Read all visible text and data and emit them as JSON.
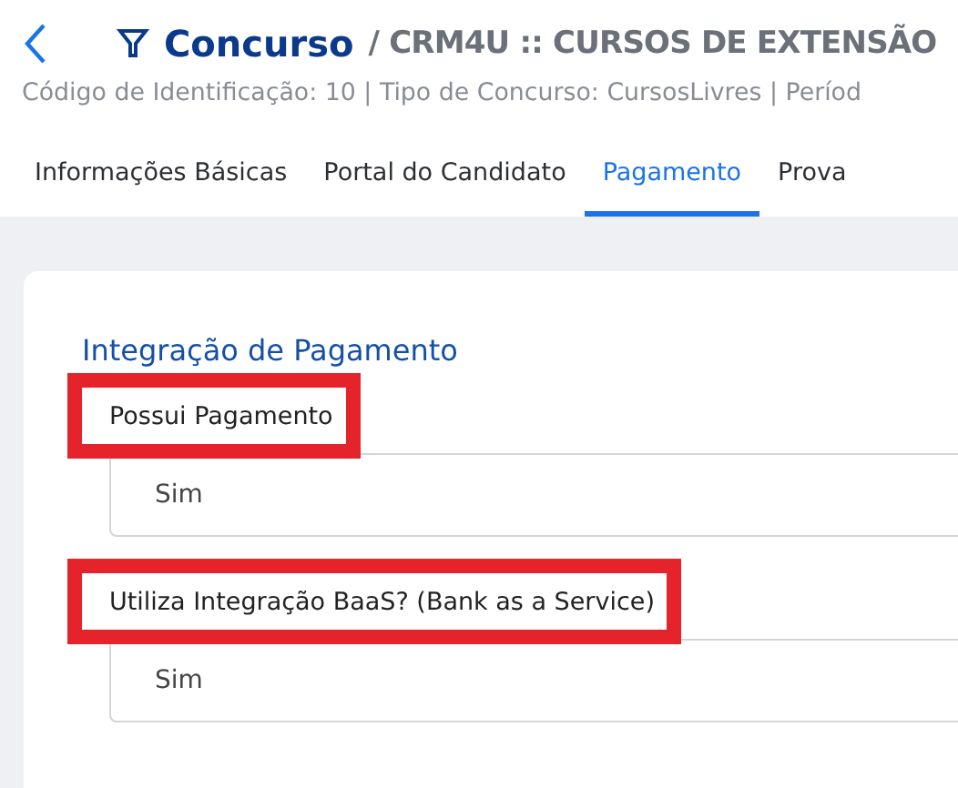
{
  "header": {
    "title": "Concurso",
    "subtitle": "/ CRM4U :: CURSOS DE EXTENSÃO",
    "details": "Código de Identificação: 10 | Tipo de Concurso: CursosLivres | Períod"
  },
  "tabs": [
    {
      "label": "Informações Básicas",
      "selected": false
    },
    {
      "label": "Portal do Candidato",
      "selected": false
    },
    {
      "label": "Pagamento",
      "selected": true
    },
    {
      "label": "Prova",
      "selected": false
    }
  ],
  "section": {
    "title": "Integração de Pagamento",
    "fields": [
      {
        "label": "Possui Pagamento",
        "value": "Sim",
        "highlighted": true
      },
      {
        "label": "Utiliza Integração BaaS? (Bank as a Service)",
        "value": "Sim",
        "highlighted": true
      }
    ]
  }
}
